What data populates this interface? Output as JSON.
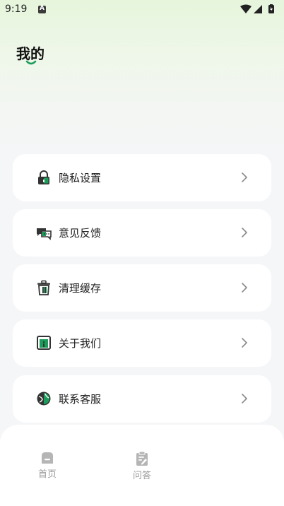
{
  "status_bar": {
    "time": "9:19",
    "notification_badge": "A",
    "icons": [
      "wifi-icon",
      "signal-icon",
      "battery-icon"
    ]
  },
  "header": {
    "title": "我的"
  },
  "menu": [
    {
      "label": "隐私设置",
      "icon": "lock-icon"
    },
    {
      "label": "意见反馈",
      "icon": "chat-bubbles-icon"
    },
    {
      "label": "清理缓存",
      "icon": "trash-icon"
    },
    {
      "label": "关于我们",
      "icon": "info-window-icon"
    },
    {
      "label": "联系客服",
      "icon": "globe-icon"
    }
  ],
  "bottom_nav": [
    {
      "label": "首页",
      "icon": "home-icon"
    },
    {
      "label": "问答",
      "icon": "clipboard-edit-icon"
    }
  ],
  "colors": {
    "accent": "#1c9c5a",
    "icon_dark": "#333333",
    "nav_inactive": "#b5b5b5"
  }
}
